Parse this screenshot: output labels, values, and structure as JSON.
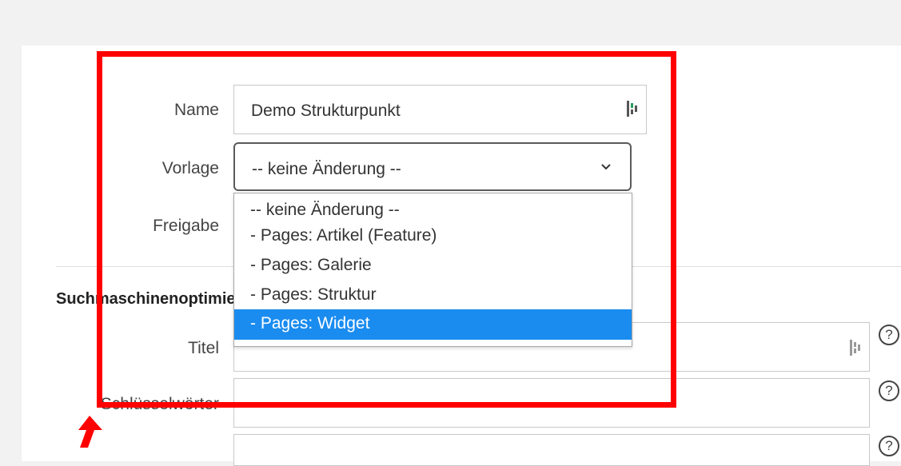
{
  "form": {
    "name_label": "Name",
    "name_value": "Demo Strukturpunkt",
    "template_label": "Vorlage",
    "template_selected": "-- keine Änderung --",
    "release_label": "Freigabe"
  },
  "dropdown": {
    "options": [
      "-- keine Änderung --",
      "- Pages: Artikel (Feature)",
      "- Pages: Galerie",
      "- Pages: Struktur",
      "- Pages: Widget"
    ],
    "highlighted_index": 4,
    "highlight_color": "#1a8cf0"
  },
  "seo": {
    "section_title": "Suchmaschinenoptimierung",
    "title_label": "Titel",
    "keywords_label": "Schlüsselwörter"
  },
  "annotation": {
    "box_color": "#ff0000"
  },
  "icons": {
    "pages_icon": "pages-logo-icon",
    "help_icon": "help-circle-icon",
    "help_glyph": "?",
    "chevron": "chevron-down-icon"
  }
}
